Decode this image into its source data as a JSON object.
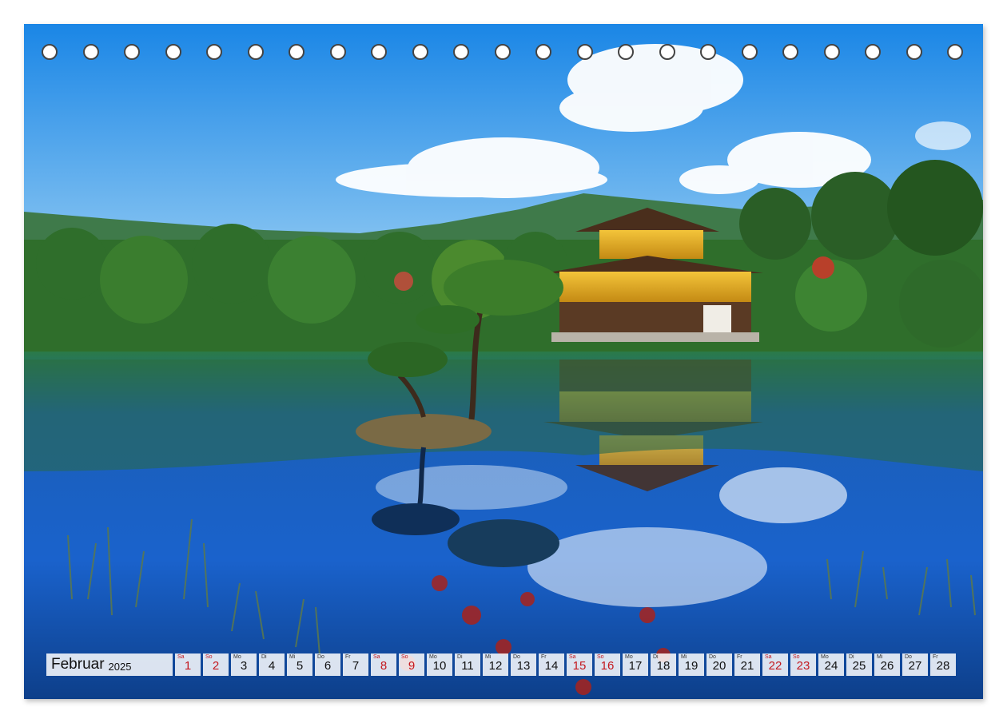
{
  "calendar": {
    "month": "Februar",
    "year": "2025",
    "weekend_color": "#c4181e",
    "days": [
      {
        "dow": "Sa",
        "num": "1",
        "weekend": true
      },
      {
        "dow": "So",
        "num": "2",
        "weekend": true
      },
      {
        "dow": "Mo",
        "num": "3",
        "weekend": false
      },
      {
        "dow": "Di",
        "num": "4",
        "weekend": false
      },
      {
        "dow": "Mi",
        "num": "5",
        "weekend": false
      },
      {
        "dow": "Do",
        "num": "6",
        "weekend": false
      },
      {
        "dow": "Fr",
        "num": "7",
        "weekend": false
      },
      {
        "dow": "Sa",
        "num": "8",
        "weekend": true
      },
      {
        "dow": "So",
        "num": "9",
        "weekend": true
      },
      {
        "dow": "Mo",
        "num": "10",
        "weekend": false
      },
      {
        "dow": "Di",
        "num": "11",
        "weekend": false
      },
      {
        "dow": "Mi",
        "num": "12",
        "weekend": false
      },
      {
        "dow": "Do",
        "num": "13",
        "weekend": false
      },
      {
        "dow": "Fr",
        "num": "14",
        "weekend": false
      },
      {
        "dow": "Sa",
        "num": "15",
        "weekend": true
      },
      {
        "dow": "So",
        "num": "16",
        "weekend": true
      },
      {
        "dow": "Mo",
        "num": "17",
        "weekend": false
      },
      {
        "dow": "Di",
        "num": "18",
        "weekend": false
      },
      {
        "dow": "Mi",
        "num": "19",
        "weekend": false
      },
      {
        "dow": "Do",
        "num": "20",
        "weekend": false
      },
      {
        "dow": "Fr",
        "num": "21",
        "weekend": false
      },
      {
        "dow": "Sa",
        "num": "22",
        "weekend": true
      },
      {
        "dow": "So",
        "num": "23",
        "weekend": true
      },
      {
        "dow": "Mo",
        "num": "24",
        "weekend": false
      },
      {
        "dow": "Di",
        "num": "25",
        "weekend": false
      },
      {
        "dow": "Mi",
        "num": "26",
        "weekend": false
      },
      {
        "dow": "Do",
        "num": "27",
        "weekend": false
      },
      {
        "dow": "Fr",
        "num": "28",
        "weekend": false
      }
    ]
  },
  "binding_holes": 23,
  "photo": {
    "sky_color": "#2a8fe0",
    "water_color": "#1466c8",
    "foliage_color": "#2e6b2a",
    "pavilion_gold": "#d9a21c"
  }
}
